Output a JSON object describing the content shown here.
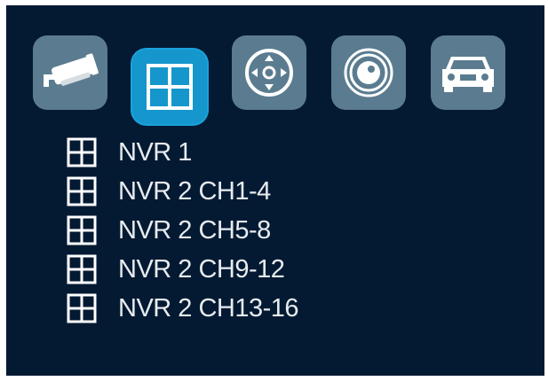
{
  "toolbar": {
    "tools": [
      {
        "name": "camera-icon"
      },
      {
        "name": "layout-grid-icon",
        "active": true
      },
      {
        "name": "ptz-control-icon"
      },
      {
        "name": "record-icon"
      },
      {
        "name": "vehicle-icon"
      }
    ]
  },
  "tree": {
    "items": [
      {
        "label": "NVR 1"
      },
      {
        "label": "NVR 2 CH1-4"
      },
      {
        "label": "NVR 2 CH5-8"
      },
      {
        "label": "NVR 2 CH9-12"
      },
      {
        "label": "NVR 2 CH13-16"
      }
    ]
  },
  "colors": {
    "panel_bg": "#041a33",
    "tool_bg": "#5b7c90",
    "tool_active_bg": "#1596cc",
    "text": "#e8ecef"
  }
}
